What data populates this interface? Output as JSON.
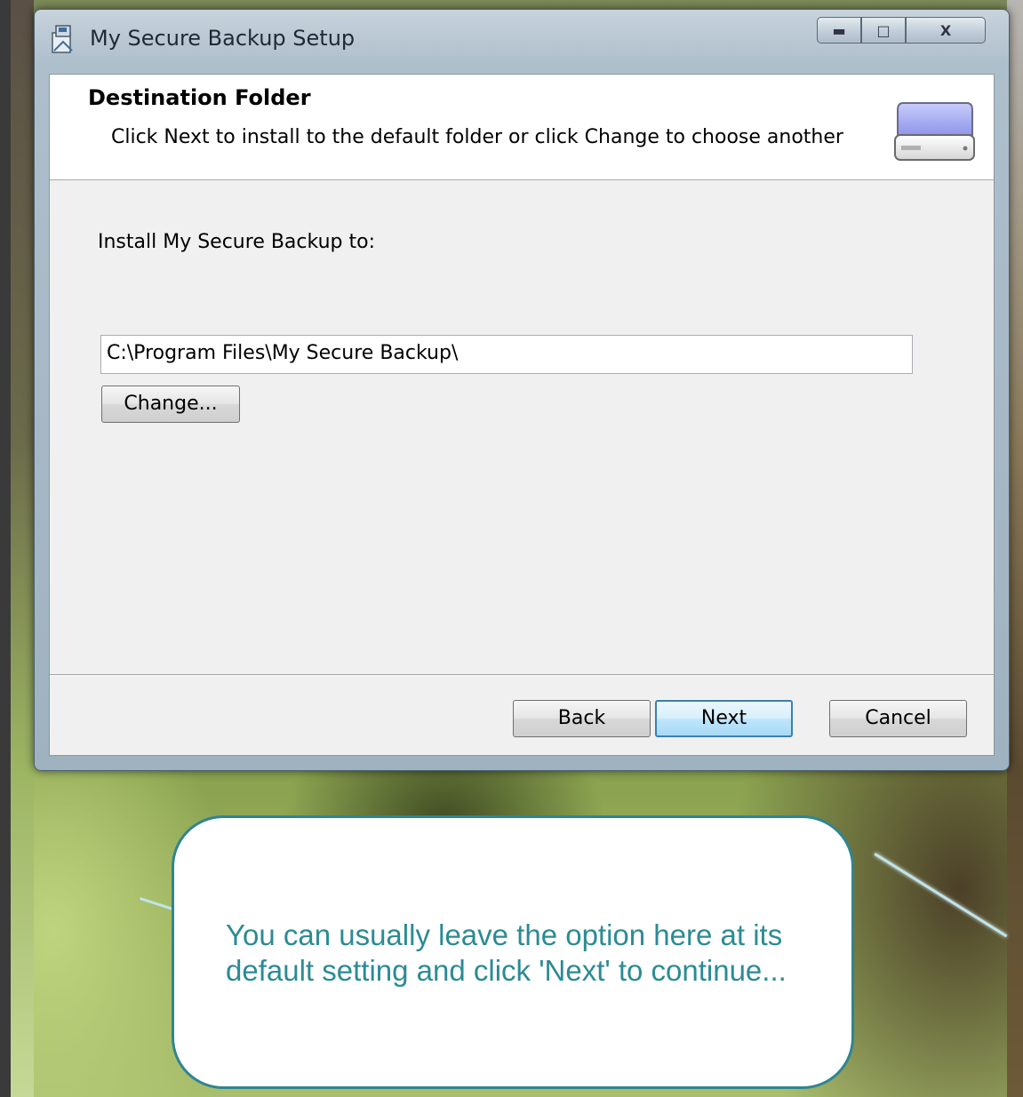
{
  "window": {
    "title": "My Secure Backup Setup",
    "controls": {
      "minimize": "minimize",
      "maximize": "maximize",
      "close": "close"
    }
  },
  "header": {
    "title": "Destination Folder",
    "description": "Click Next to install to the default folder or click Change to choose another"
  },
  "main": {
    "install_label": "Install My Secure Backup to:",
    "path_value": "C:\\Program Files\\My Secure Backup\\",
    "change_label": "Change..."
  },
  "footer": {
    "back_label": "Back",
    "next_label": "Next",
    "cancel_label": "Cancel"
  },
  "callout": {
    "text": "You can usually leave the option here at its default setting and click 'Next' to continue..."
  },
  "icons": {
    "app": "installer-package-icon",
    "header": "hard-drive-icon"
  },
  "colors": {
    "callout_text": "#2b8b94",
    "callout_border": "#2f8591",
    "default_button_border": "#3c7fb1"
  }
}
